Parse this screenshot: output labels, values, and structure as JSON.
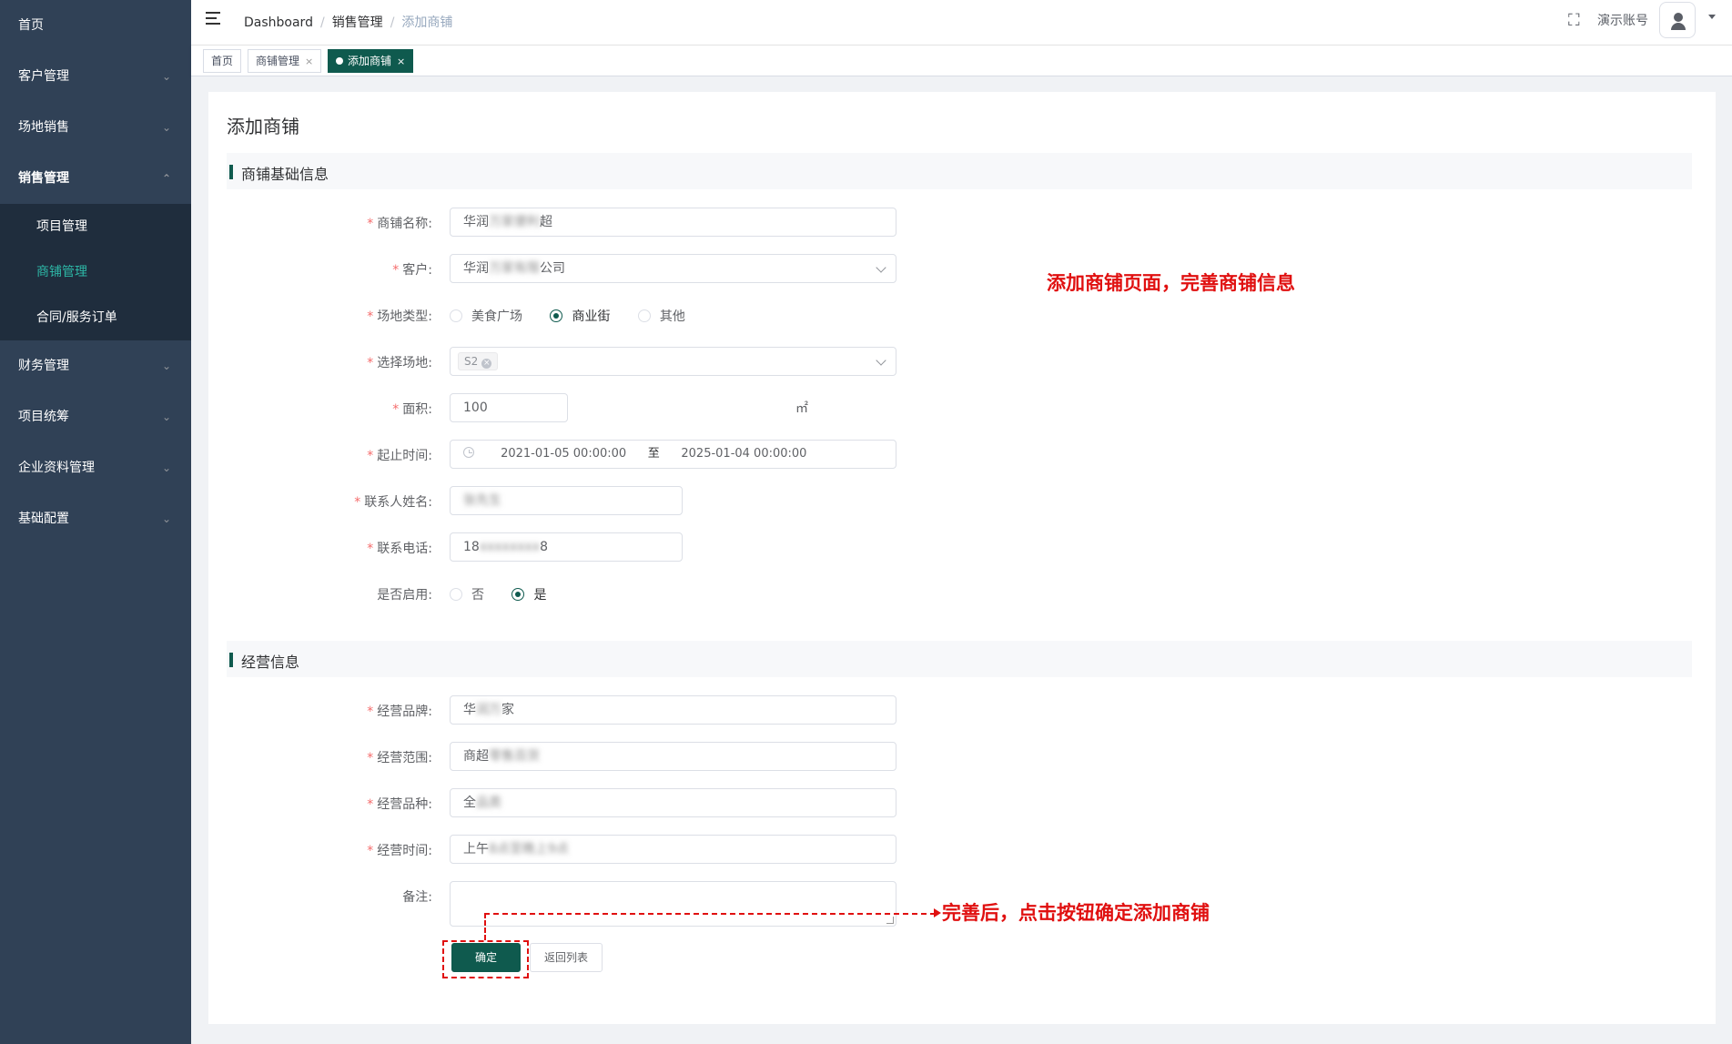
{
  "sidebar": {
    "items": [
      {
        "label": "首页",
        "arrow": ""
      },
      {
        "label": "客户管理",
        "arrow": "⌄"
      },
      {
        "label": "场地销售",
        "arrow": "⌄"
      },
      {
        "label": "销售管理",
        "arrow": "⌃"
      },
      {
        "label": "财务管理",
        "arrow": "⌄"
      },
      {
        "label": "项目统筹",
        "arrow": "⌄"
      },
      {
        "label": "企业资料管理",
        "arrow": "⌄"
      },
      {
        "label": "基础配置",
        "arrow": "⌄"
      }
    ],
    "sub_items": [
      "项目管理",
      "商铺管理",
      "合同/服务订单"
    ]
  },
  "header": {
    "breadcrumb": [
      "Dashboard",
      "销售管理",
      "添加商铺"
    ],
    "account_name": "演示账号"
  },
  "tags": [
    {
      "label": "首页",
      "close": ""
    },
    {
      "label": "商铺管理",
      "close": "×"
    },
    {
      "label": "添加商铺",
      "close": "×"
    }
  ],
  "page": {
    "title": "添加商铺",
    "section_basic": "商铺基础信息",
    "section_business": "经营信息"
  },
  "form_basic": {
    "shop_name": {
      "label": "商铺名称:",
      "value_prefix": "华润",
      "value_blur": "万家便利",
      "value_suffix": "超"
    },
    "customer": {
      "label": "客户:",
      "value_prefix": "华润",
      "value_blur": "万家有限",
      "value_suffix": "公司"
    },
    "venue_type": {
      "label": "场地类型:",
      "options": [
        "美食广场",
        "商业街",
        "其他"
      ],
      "selected": "商业街"
    },
    "venue": {
      "label": "选择场地:",
      "chip": "S2",
      "chip_close": "×"
    },
    "area": {
      "label": "面积:",
      "value": "100",
      "unit": "㎡"
    },
    "period": {
      "label": "起止时间:",
      "start": "2021-01-05 00:00:00",
      "separator": "至",
      "end": "2025-01-04 00:00:00"
    },
    "contact_name": {
      "label": "联系人姓名:",
      "value_blur": "张先生"
    },
    "contact_phone": {
      "label": "联系电话:",
      "value_prefix": "18",
      "value_blur": "xxxxxxxx",
      "value_suffix": "8"
    },
    "enabled": {
      "label": "是否启用:",
      "options": [
        "否",
        "是"
      ],
      "selected": "是"
    }
  },
  "form_business": {
    "brand": {
      "label": "经营品牌:",
      "value_prefix": "华",
      "value_blur": "润万",
      "value_suffix": "家"
    },
    "scope": {
      "label": "经营范围:",
      "value_prefix": "商超",
      "value_blur": "零售百货"
    },
    "category": {
      "label": "经营品种:",
      "value_prefix": "全",
      "value_blur": "品类"
    },
    "hours": {
      "label": "经营时间:",
      "value_prefix": "上午",
      "value_blur": "8点至晚上9点"
    },
    "remark": {
      "label": "备注:"
    }
  },
  "buttons": {
    "confirm": "确定",
    "back": "返回列表"
  },
  "annotations": {
    "note1": "添加商铺页面，完善商铺信息",
    "note2": "完善后，点击按钮确定添加商铺"
  },
  "colors": {
    "sidebar_bg": "#304156",
    "primary": "#0f5a4e",
    "annotation": "#e01010"
  }
}
